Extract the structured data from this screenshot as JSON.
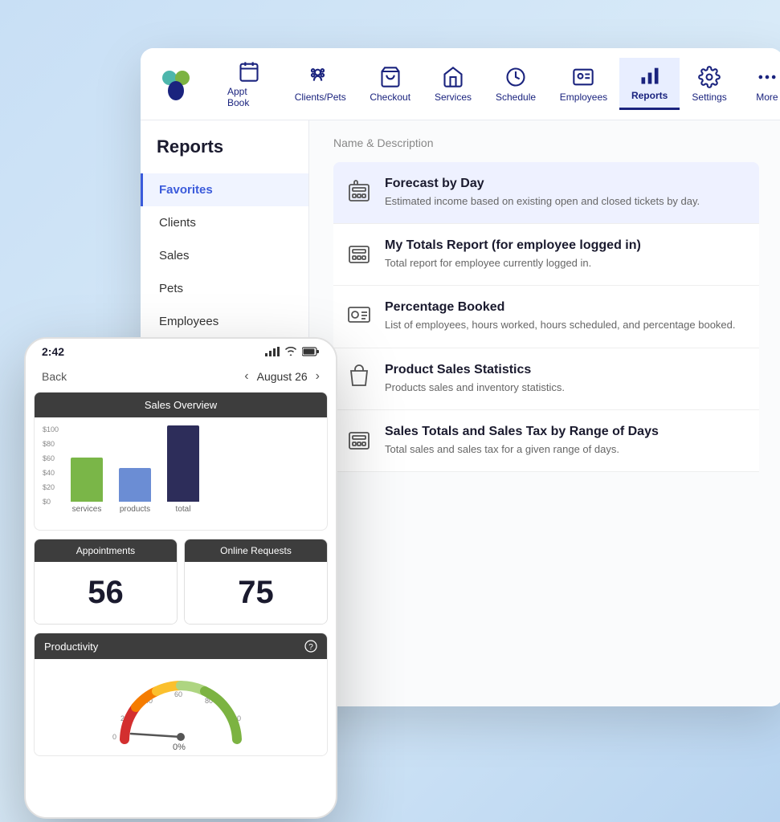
{
  "app": {
    "title": "Reports"
  },
  "nav": {
    "items": [
      {
        "id": "appt-book",
        "label": "Appt Book",
        "icon": "calendar"
      },
      {
        "id": "clients-pets",
        "label": "Clients/Pets",
        "icon": "paw"
      },
      {
        "id": "checkout",
        "label": "Checkout",
        "icon": "cart"
      },
      {
        "id": "services",
        "label": "Services",
        "icon": "house"
      },
      {
        "id": "schedule",
        "label": "Schedule",
        "icon": "clock"
      },
      {
        "id": "employees",
        "label": "Employees",
        "icon": "badge"
      },
      {
        "id": "reports",
        "label": "Reports",
        "icon": "chart",
        "active": true
      },
      {
        "id": "settings",
        "label": "Settings",
        "icon": "gear"
      },
      {
        "id": "more",
        "label": "More",
        "icon": "dots"
      }
    ]
  },
  "sidebar": {
    "items": [
      {
        "id": "favorites",
        "label": "Favorites",
        "active": true
      },
      {
        "id": "clients",
        "label": "Clients"
      },
      {
        "id": "sales",
        "label": "Sales"
      },
      {
        "id": "pets",
        "label": "Pets"
      },
      {
        "id": "employees",
        "label": "Employees"
      }
    ]
  },
  "reports": {
    "column_header": "Name & Description",
    "items": [
      {
        "id": "forecast-by-day",
        "name": "Forecast by Day",
        "description": "Estimated income based on existing open and closed tickets by day.",
        "icon": "register"
      },
      {
        "id": "my-totals",
        "name": "My Totals Report (for employee logged in)",
        "description": "Total report for employee currently logged in.",
        "icon": "register"
      },
      {
        "id": "percentage-booked",
        "name": "Percentage Booked",
        "description": "List of employees, hours worked, hours scheduled, and percentage booked.",
        "icon": "id-card"
      },
      {
        "id": "product-sales",
        "name": "Product Sales Statistics",
        "description": "Products sales and inventory statistics.",
        "icon": "bag"
      },
      {
        "id": "sales-totals",
        "name": "Sales Totals and Sales Tax by Range of Days",
        "description": "Total sales and sales tax for a given range of days.",
        "icon": "register"
      }
    ]
  },
  "mobile": {
    "status_bar": {
      "time": "2:42",
      "signal": "●●●●",
      "wifi": "wifi",
      "battery": "battery"
    },
    "nav": {
      "back_label": "Back",
      "date": "August 26"
    },
    "sales_overview": {
      "title": "Sales Overview",
      "y_labels": [
        "$100",
        "$80",
        "$60",
        "$40",
        "$20",
        "$0"
      ],
      "bars": [
        {
          "label": "services",
          "color": "#7ab648",
          "height": 55
        },
        {
          "label": "products",
          "color": "#6b8dd4",
          "height": 42
        },
        {
          "label": "total",
          "color": "#2d2d5a",
          "height": 95
        }
      ]
    },
    "stats": [
      {
        "header": "Appointments",
        "value": "56"
      },
      {
        "header": "Online Requests",
        "value": "75"
      }
    ],
    "productivity": {
      "title": "Productivity",
      "value_label": "0%"
    }
  }
}
